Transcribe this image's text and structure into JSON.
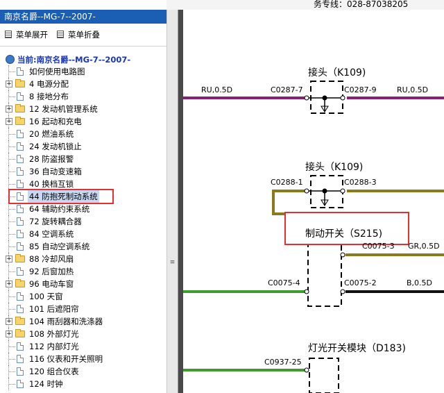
{
  "top": {
    "service_text": "务专线：028-87038205"
  },
  "left": {
    "title": "南京名爵--MG-7--2007-",
    "toolbar": {
      "expand_label": "菜单展开",
      "collapse_label": "菜单折叠"
    },
    "root_label": "当前:南京名爵--MG-7--2007-",
    "items": [
      {
        "label": "如何使用电路图",
        "kind": "doc",
        "expandable": false
      },
      {
        "label": "4 电源分配",
        "kind": "folder",
        "expandable": true
      },
      {
        "label": "8 接地分布",
        "kind": "doc",
        "expandable": false
      },
      {
        "label": "12 发动机管理系统",
        "kind": "folder",
        "expandable": true
      },
      {
        "label": "16 起动和充电",
        "kind": "folder",
        "expandable": true
      },
      {
        "label": "20 燃油系统",
        "kind": "doc",
        "expandable": false
      },
      {
        "label": "24 发动机锁止",
        "kind": "doc",
        "expandable": false
      },
      {
        "label": "28 防盗报警",
        "kind": "doc",
        "expandable": false
      },
      {
        "label": "36 自动变速箱",
        "kind": "doc",
        "expandable": false
      },
      {
        "label": "40 换档互锁",
        "kind": "doc",
        "expandable": false
      },
      {
        "label": "44 防抱死制动系统",
        "kind": "doc",
        "expandable": false,
        "selected": true
      },
      {
        "label": "64 辅助约束系统",
        "kind": "doc",
        "expandable": false
      },
      {
        "label": "72 旋转耦合器",
        "kind": "doc",
        "expandable": false
      },
      {
        "label": "84 空调系统",
        "kind": "doc",
        "expandable": false
      },
      {
        "label": "85 自动空调系统",
        "kind": "doc",
        "expandable": false
      },
      {
        "label": "88 冷却风扇",
        "kind": "folder",
        "expandable": true
      },
      {
        "label": "92 后窗加热",
        "kind": "doc",
        "expandable": false
      },
      {
        "label": "96 电动车窗",
        "kind": "folder",
        "expandable": true
      },
      {
        "label": "100 天窗",
        "kind": "doc",
        "expandable": false
      },
      {
        "label": "101 后遮阳帘",
        "kind": "doc",
        "expandable": false
      },
      {
        "label": "104 雨刮器和洗涤器",
        "kind": "folder",
        "expandable": true
      },
      {
        "label": "108 外部灯光",
        "kind": "folder",
        "expandable": true
      },
      {
        "label": "112 内部灯光",
        "kind": "doc",
        "expandable": false
      },
      {
        "label": "116 仪表和开关照明",
        "kind": "doc",
        "expandable": false
      },
      {
        "label": "120 组合仪表",
        "kind": "doc",
        "expandable": false
      },
      {
        "label": "124 时钟",
        "kind": "doc",
        "expandable": false
      }
    ]
  },
  "diagram": {
    "connector1": {
      "title": "接头（K109)",
      "left_pin": "C0287-7",
      "right_pin": "C0287-9",
      "left_wire": "RU,0.5D",
      "right_wire": "RU,0.5D"
    },
    "connector2": {
      "title": "接头（K109)",
      "left_pin": "C0288-1",
      "right_pin": "C0288-3"
    },
    "switch": {
      "title": "制动开关（S215)",
      "pin_top_right": "C0075-3",
      "wire_top_right": "GR,0.5D",
      "pin_left": "C0075-4",
      "pin_right": "C0075-2",
      "wire_right": "B,0.5D"
    },
    "module": {
      "title": "灯光开关模块（D183)",
      "pin": "C0937-25"
    },
    "colors": {
      "purple_wire": "#8a1f7a",
      "olive_wire": "#8a7a1c",
      "green_wire": "#3f9b2f",
      "annotation_red": "#e53030"
    }
  }
}
